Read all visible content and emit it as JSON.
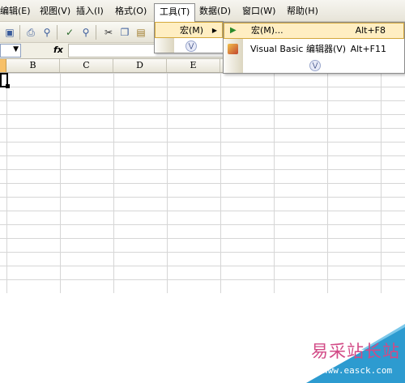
{
  "menubar": {
    "items": [
      {
        "label": "编辑(E)",
        "name": "menu-edit"
      },
      {
        "label": "视图(V)",
        "name": "menu-view"
      },
      {
        "label": "插入(I)",
        "name": "menu-insert"
      },
      {
        "label": "格式(O)",
        "name": "menu-format"
      },
      {
        "label": "工具(T)",
        "name": "menu-tools"
      },
      {
        "label": "数据(D)",
        "name": "menu-data"
      },
      {
        "label": "窗口(W)",
        "name": "menu-window"
      },
      {
        "label": "帮助(H)",
        "name": "menu-help"
      }
    ],
    "open_menu": "工具(T)"
  },
  "toolbar": {
    "icons": [
      "new-icon",
      "print-icon",
      "print-preview-icon",
      "spelling-icon",
      "research-icon",
      "cut-icon",
      "copy-icon",
      "paste-icon"
    ]
  },
  "formula_bar": {
    "fx_label": "fx",
    "name_box_value": "",
    "formula_value": ""
  },
  "grid": {
    "columns": [
      "B",
      "C",
      "D",
      "E"
    ]
  },
  "tools_menu": {
    "items": [
      {
        "label": "宏(M)",
        "has_submenu": true,
        "highlighted": true
      }
    ],
    "expand_icon": "chevron-double-down-icon"
  },
  "macro_submenu": {
    "items": [
      {
        "label": "宏(M)...",
        "shortcut": "Alt+F8",
        "icon": "play-icon",
        "highlighted": true
      },
      {
        "label": "Visual Basic 编辑器(V)",
        "shortcut": "Alt+F11",
        "icon": "vb-editor-icon",
        "highlighted": false
      }
    ],
    "expand_icon": "chevron-double-down-icon"
  },
  "watermark": {
    "title": "易采站长站",
    "url": "www.easck.com",
    "colors": {
      "blue": "#2d9bd0",
      "pink": "#d24a86"
    }
  },
  "colors": {
    "menu_highlight": "#ffeec2",
    "menu_highlight_border": "#d4a83c",
    "selected_header": "#f7c068"
  }
}
